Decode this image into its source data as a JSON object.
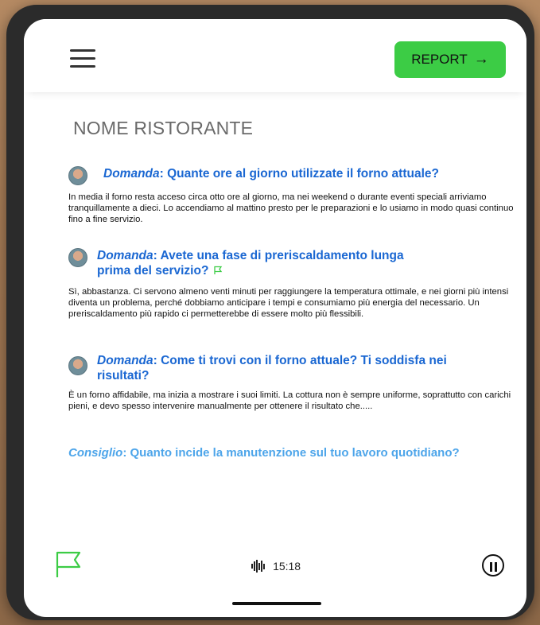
{
  "header": {
    "report_label": "REPORT",
    "report_arrow": "→",
    "menu_icon": "hamburger-icon"
  },
  "page": {
    "title": "NOME RISTORANTE"
  },
  "qa": [
    {
      "label": "Domanda",
      "question": ": Quante ore al giorno utilizzate il forno attuale?",
      "answer": "In media il forno resta acceso circa otto ore al giorno, ma nei weekend o durante eventi speciali arriviamo tranquillamente a dieci. Lo accendiamo al mattino presto per le preparazioni e lo usiamo in modo quasi continuo fino a fine servizio.",
      "flagged": false
    },
    {
      "label": "Domanda",
      "question": ": Avete una fase di preriscaldamento lunga prima del servizio?",
      "answer": "Sì, abbastanza. Ci servono almeno venti minuti per raggiungere la temperatura ottimale, e nei giorni più intensi diventa un problema, perché dobbiamo anticipare i tempi e consumiamo più energia del necessario. Un preriscaldamento più rapido ci permetterebbe di essere molto più flessibili.",
      "flagged": true
    },
    {
      "label": "Domanda",
      "question": ": Come ti trovi con il forno attuale? Ti soddisfa nei risultati?",
      "answer": "È un forno affidabile, ma inizia a mostrare i suoi limiti. La cottura non è sempre uniforme, soprattutto con carichi pieni, e devo spesso intervenire manualmente per ottenere il risultato che.....",
      "flagged": false
    }
  ],
  "hint": {
    "label": "Consiglio",
    "text": ": Quanto incide la manutenzione sul tuo lavoro quotidiano?"
  },
  "footer": {
    "timer": "15:18",
    "flag_icon": "flag-icon",
    "pause_icon": "pause-icon",
    "wave_icon": "audio-wave-icon"
  },
  "colors": {
    "accent_green": "#3ccc45",
    "question_blue": "#1a67d2",
    "hint_blue": "#4da5ea"
  }
}
